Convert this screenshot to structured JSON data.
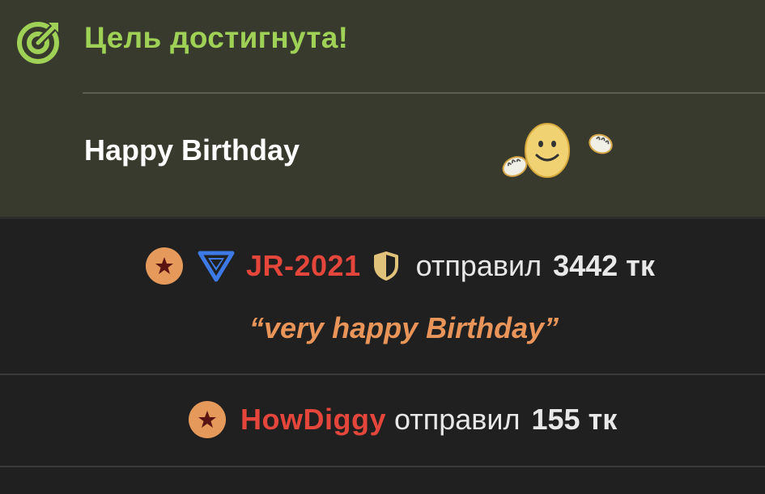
{
  "goal": {
    "title": "Цель достигнута!",
    "message": "Happy Birthday",
    "accent_color": "#9ed155",
    "icon": "target-check-icon",
    "sticker": "smiley-sticker-icon"
  },
  "tips": [
    {
      "username": "JR-2021",
      "action": "отправил",
      "amount": "3442 тк",
      "message": "“very happy Birthday”",
      "badges": [
        "star-badge-icon",
        "tier-triangle-icon",
        "shield-icon"
      ]
    },
    {
      "username": "HowDiggy",
      "action": "отправил",
      "amount": "155 тк",
      "badges": [
        "star-badge-icon"
      ]
    }
  ],
  "colors": {
    "username": "#e5463b",
    "message": "#e9955a",
    "goal_bg": "#383a2e",
    "feed_bg": "#202020"
  }
}
